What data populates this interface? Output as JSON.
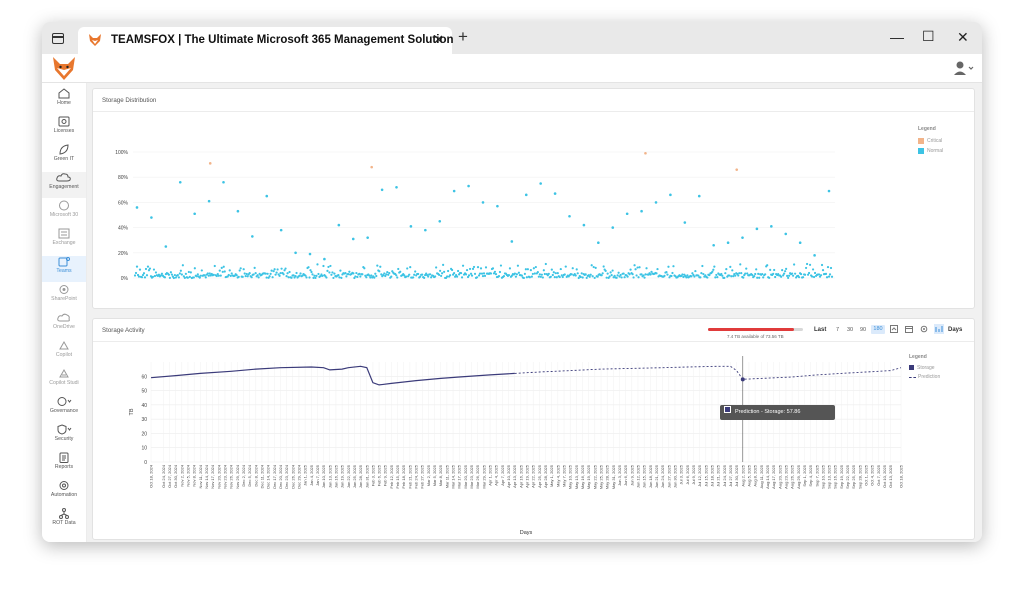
{
  "browser": {
    "tab_title": "TEAMSFOX | The Ultimate Microsoft 365 Management Solution",
    "tab_close": "✕",
    "new_tab": "+",
    "minimize": "—",
    "maximize": "☐",
    "close": "✕"
  },
  "sidebar": {
    "items": [
      {
        "label": "Home",
        "icon": "home-icon"
      },
      {
        "label": "Licenses",
        "icon": "license-icon"
      },
      {
        "label": "Green IT",
        "icon": "leaf-icon"
      },
      {
        "label": "Engagement",
        "icon": "cloud-icon"
      },
      {
        "label": "Microsoft 30",
        "icon": "microsoft-365-icon"
      },
      {
        "label": "Exchange",
        "icon": "exchange-icon"
      },
      {
        "label": "Teams",
        "icon": "teams-icon"
      },
      {
        "label": "SharePoint",
        "icon": "sharepoint-icon"
      },
      {
        "label": "OneDrive",
        "icon": "onedrive-icon"
      },
      {
        "label": "Copilot",
        "icon": "copilot-icon"
      },
      {
        "label": "Copilot Studi",
        "icon": "copilot-studio-icon"
      },
      {
        "label": "Governance",
        "icon": "governance-icon"
      },
      {
        "label": "Security",
        "icon": "shield-icon"
      },
      {
        "label": "Reports",
        "icon": "report-icon"
      },
      {
        "label": "Automation",
        "icon": "automation-icon"
      },
      {
        "label": "ROT Data",
        "icon": "rot-data-icon"
      }
    ]
  },
  "storage_distribution": {
    "title": "Storage Distribution",
    "legend_title": "Legend",
    "legend": [
      {
        "name": "Critical",
        "color": "#f2b48a"
      },
      {
        "name": "Normal",
        "color": "#3cc3e4"
      }
    ]
  },
  "storage_activity": {
    "title": "Storage Activity",
    "capacity_text": "7.4 TB available of 73.56 TB",
    "capacity_used_fraction": 0.9,
    "last_label": "Last",
    "range_options": [
      "7",
      "30",
      "90",
      "180"
    ],
    "selected_range": "180",
    "days_label": "Days",
    "legend_title": "Legend",
    "tooltip": "Prediction - Storage: 57.86"
  },
  "chart_data": [
    {
      "type": "scatter",
      "title": "Storage Distribution",
      "ylim": [
        0,
        100
      ],
      "yticks": [
        "0%",
        "20%",
        "40%",
        "60%",
        "80%",
        "100%"
      ],
      "series": [
        {
          "name": "Critical",
          "color": "#f2b48a",
          "values": [
            91,
            88,
            99,
            86
          ]
        },
        {
          "name": "Normal",
          "color": "#3cc3e4",
          "values": [
            56,
            48,
            25,
            76,
            51,
            61,
            76,
            53,
            33,
            65,
            38,
            20,
            19,
            15,
            42,
            31,
            32,
            70,
            72,
            41,
            38,
            45,
            69,
            73,
            60,
            57,
            29,
            66,
            75,
            67,
            49,
            42,
            28,
            40,
            51,
            53,
            60,
            66,
            44,
            65,
            26,
            28,
            32,
            39,
            41,
            35,
            28,
            18,
            69
          ]
        }
      ]
    },
    {
      "type": "line",
      "title": "Storage Activity",
      "xlabel": "Days",
      "ylabel": "TB",
      "ylim": [
        0,
        70
      ],
      "yticks": [
        0,
        10,
        20,
        30,
        40,
        50,
        60
      ],
      "x_start": "Oct 18, 2024",
      "x_end": "Oct 18, 2025",
      "x_tick_labels": [
        "Oct 18, 2024",
        "Oct 24, 2024",
        "Oct 27, 2024",
        "Oct 30, 2024",
        "Nov 2, 2024",
        "Nov 5, 2024",
        "Nov 8, 2024",
        "Nov 11, 2024",
        "Nov 14, 2024",
        "Nov 17, 2024",
        "Nov 20, 2024",
        "Nov 23, 2024",
        "Nov 26, 2024",
        "Nov 29, 2024",
        "Dec 2, 2024",
        "Dec 5, 2024",
        "Dec 8, 2024",
        "Dec 11, 2024",
        "Dec 14, 2024",
        "Dec 17, 2024",
        "Dec 20, 2024",
        "Dec 23, 2024",
        "Dec 26, 2024",
        "Dec 29, 2024",
        "Jan 1, 2025",
        "Jan 4, 2025",
        "Jan 7, 2025",
        "Jan 10, 2025",
        "Jan 13, 2025",
        "Jan 16, 2025",
        "Jan 19, 2025",
        "Jan 22, 2025",
        "Jan 25, 2025",
        "Jan 28, 2025",
        "Jan 31, 2025",
        "Feb 3, 2025",
        "Feb 6, 2025",
        "Feb 9, 2025",
        "Feb 12, 2025",
        "Feb 15, 2025",
        "Feb 18, 2025",
        "Feb 21, 2025",
        "Feb 24, 2025",
        "Feb 27, 2025",
        "Mar 2, 2025",
        "Mar 5, 2025",
        "Mar 8, 2025",
        "Mar 11, 2025",
        "Mar 14, 2025",
        "Mar 17, 2025",
        "Mar 20, 2025",
        "Mar 23, 2025",
        "Mar 26, 2025",
        "Mar 29, 2025",
        "Apr 1, 2025",
        "Apr 4, 2025",
        "Apr 7, 2025",
        "Apr 10, 2025",
        "Apr 13, 2025",
        "Apr 16, 2025",
        "Apr 19, 2025",
        "Apr 22, 2025",
        "Apr 25, 2025",
        "Apr 28, 2025",
        "May 1, 2025",
        "May 4, 2025",
        "May 7, 2025",
        "May 10, 2025",
        "May 13, 2025",
        "May 16, 2025",
        "May 19, 2025",
        "May 22, 2025",
        "May 25, 2025",
        "May 28, 2025",
        "May 31, 2025",
        "Jun 3, 2025",
        "Jun 6, 2025",
        "Jun 9, 2025",
        "Jun 12, 2025",
        "Jun 15, 2025",
        "Jun 18, 2025",
        "Jun 21, 2025",
        "Jun 24, 2025",
        "Jun 27, 2025",
        "Jun 30, 2025",
        "Jul 3, 2025",
        "Jul 6, 2025",
        "Jul 9, 2025",
        "Jul 12, 2025",
        "Jul 15, 2025",
        "Jul 18, 2025",
        "Jul 21, 2025",
        "Jul 24, 2025",
        "Jul 27, 2025",
        "Jul 30, 2025",
        "Aug 2, 2025",
        "Aug 5, 2025",
        "Aug 8, 2025",
        "Aug 11, 2025",
        "Aug 14, 2025",
        "Aug 17, 2025",
        "Aug 20, 2025",
        "Aug 23, 2025",
        "Aug 26, 2025",
        "Aug 29, 2025",
        "Sep 1, 2025",
        "Sep 4, 2025",
        "Sep 7, 2025",
        "Sep 10, 2025",
        "Sep 13, 2025",
        "Sep 16, 2025",
        "Sep 19, 2025",
        "Sep 22, 2025",
        "Sep 25, 2025",
        "Sep 28, 2025",
        "Oct 1, 2025",
        "Oct 4, 2025",
        "Oct 7, 2025",
        "Oct 10, 2025",
        "Oct 13, 2025",
        "Oct 18, 2025"
      ],
      "series": [
        {
          "name": "Storage",
          "color": "#3b3b7a",
          "style": "solid",
          "points": [
            [
              "Oct 18, 2024",
              59
            ],
            [
              "Oct 30, 2024",
              60.5
            ],
            [
              "Nov 11, 2024",
              62
            ],
            [
              "Nov 26, 2024",
              63.5
            ],
            [
              "Dec 8, 2024",
              65
            ],
            [
              "Dec 20, 2024",
              66
            ],
            [
              "Jan 4, 2025",
              66.5
            ],
            [
              "Jan 10, 2025",
              66
            ],
            [
              "Jan 13, 2025",
              64.5
            ],
            [
              "Jan 19, 2025",
              65
            ],
            [
              "Jan 22, 2025",
              66
            ],
            [
              "Jan 28, 2025",
              67
            ],
            [
              "Jan 31, 2025",
              66
            ],
            [
              "Feb 3, 2025",
              55.5
            ],
            [
              "Feb 6, 2025",
              54
            ],
            [
              "Feb 12, 2025",
              55
            ],
            [
              "Feb 24, 2025",
              57
            ],
            [
              "Mar 8, 2025",
              58.5
            ],
            [
              "Mar 17, 2025",
              59.5
            ],
            [
              "Apr 1, 2025",
              61
            ],
            [
              "Apr 13, 2025",
              62
            ]
          ]
        },
        {
          "name": "Prediction",
          "color": "#3b3b7a",
          "style": "dashed",
          "points": [
            [
              "Apr 13, 2025",
              62
            ],
            [
              "Apr 25, 2025",
              63
            ],
            [
              "May 10, 2025",
              64
            ],
            [
              "May 25, 2025",
              65
            ],
            [
              "Jun 9, 2025",
              65.5
            ],
            [
              "Jun 24, 2025",
              66
            ],
            [
              "Jul 6, 2025",
              66.5
            ],
            [
              "Jul 21, 2025",
              67
            ],
            [
              "Jul 27, 2025",
              67
            ],
            [
              "Jul 30, 2025",
              64
            ],
            [
              "Aug 2, 2025",
              57.86
            ],
            [
              "Aug 11, 2025",
              58.5
            ],
            [
              "Aug 26, 2025",
              59.5
            ],
            [
              "Sep 7, 2025",
              61
            ],
            [
              "Sep 19, 2025",
              62
            ],
            [
              "Oct 1, 2025",
              63
            ],
            [
              "Oct 13, 2025",
              64
            ],
            [
              "Oct 18, 2025",
              66
            ]
          ]
        }
      ],
      "highlight": {
        "x": "Aug 2, 2025",
        "y": 57.86
      }
    }
  ]
}
